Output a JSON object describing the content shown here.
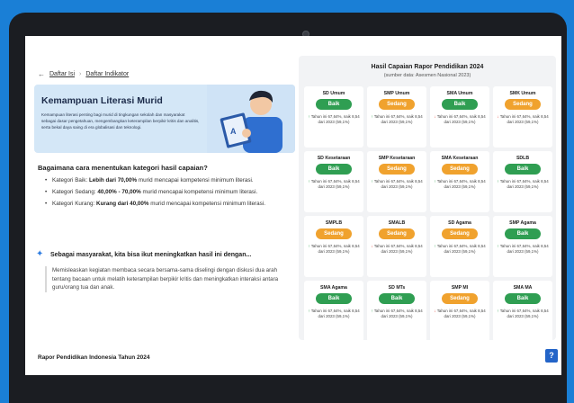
{
  "breadcrumb": {
    "back_icon": "arrow-left-icon",
    "items": [
      "Daftar Isi",
      "Daftar Indikator"
    ],
    "separator": "›"
  },
  "hero": {
    "title": "Kemampuan Literasi Murid",
    "description": "Kemampuan literasi penting bagi murid di tingkungan sekolah dan masyarakat sebagai dasar pengetahuan, mengembangkan keterampilan berpikir kritis dan analitis, serta bekal daya saing di era globalisasi dan teknologi."
  },
  "question": {
    "title": "Bagaimana cara menentukan kategori hasil capaian?",
    "bullets": [
      {
        "prefix": "Kategori Baik: ",
        "bold": "Lebih dari 70,00%",
        "suffix": " murid mencapai kompetensi minimum literasi."
      },
      {
        "prefix": "Kategori Sedang: ",
        "bold": "40,00% - 70,00%",
        "suffix": " murid mencapai kompetensi minimum literasi."
      },
      {
        "prefix": "Kategori Kurang: ",
        "bold": "Kurang dari 40,00%",
        "suffix": " murid mencapai kompetensi minimum literasi."
      }
    ]
  },
  "ai_section": {
    "icon": "sparkle-icon",
    "title": "Sebagai masyarakat, kita bisa ikut meningkatkan hasil ini dengan...",
    "body": "Memisleaskan kegiatan membaca secara bersama-sama diselingi dengan diskusi dua arah tentang bacaan untuk melatih keterampilan berpikir kritis dan meningkatkan interaksi antara guru/orang tua dan anak."
  },
  "footer": {
    "title": "Rapor Pendidikan Indonesia Tahun 2024",
    "help_label": "?"
  },
  "panel": {
    "title": "Hasil Capaian Rapor Pendidikan 2024",
    "subtitle": "(sumber data: Asesmen Nasional 2023)",
    "colors": {
      "baik": "#2f9e52",
      "sedang": "#f0a22e"
    },
    "note_text": "Tahun ini 67,64%, naik 8,54 dari 2023 (59,1%)",
    "cards": [
      {
        "name": "SD Umum",
        "status": "Baik",
        "trend": "up"
      },
      {
        "name": "SMP Umum",
        "status": "Sedang",
        "trend": "up"
      },
      {
        "name": "SMA Umum",
        "status": "Baik",
        "trend": "down"
      },
      {
        "name": "SMK Umum",
        "status": "Sedang",
        "trend": "down"
      },
      {
        "name": "SD Kesetaraan",
        "status": "Baik",
        "trend": "up"
      },
      {
        "name": "SMP Kesetaraan",
        "status": "Sedang",
        "trend": "up"
      },
      {
        "name": "SMA Kesetaraan",
        "status": "Sedang",
        "trend": "up"
      },
      {
        "name": "SDLB",
        "status": "Baik",
        "trend": "up"
      },
      {
        "name": "SMPLB",
        "status": "Sedang",
        "trend": "up"
      },
      {
        "name": "SMALB",
        "status": "Sedang",
        "trend": "down"
      },
      {
        "name": "SD Agama",
        "status": "Sedang",
        "trend": "up"
      },
      {
        "name": "SMP Agama",
        "status": "Baik",
        "trend": "up"
      },
      {
        "name": "SMA Agama",
        "status": "Baik",
        "trend": "up"
      },
      {
        "name": "SD MTs",
        "status": "Baik",
        "trend": "up"
      },
      {
        "name": "SMP MI",
        "status": "Sedang",
        "trend": "down"
      },
      {
        "name": "SMA MA",
        "status": "Baik",
        "trend": "up"
      }
    ]
  }
}
